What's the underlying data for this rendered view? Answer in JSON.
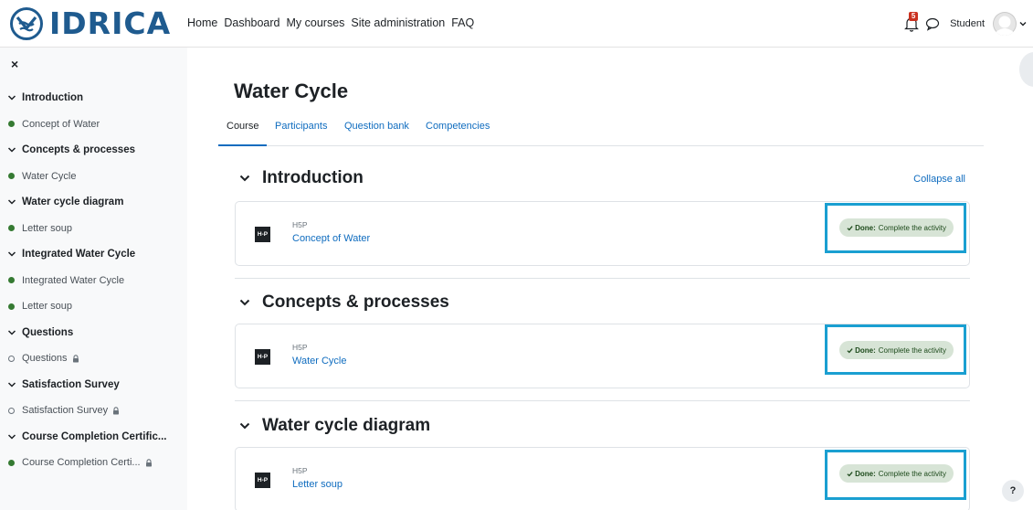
{
  "brand": {
    "name": "IDRICA"
  },
  "topnav": [
    "Home",
    "Dashboard",
    "My courses",
    "Site administration",
    "FAQ"
  ],
  "user": {
    "name": "Student",
    "notification_count": "5"
  },
  "drawer": {
    "close": "×",
    "items": [
      {
        "type": "section",
        "label": "Introduction"
      },
      {
        "type": "activity",
        "label": "Concept of Water",
        "status": "done"
      },
      {
        "type": "section",
        "label": "Concepts & processes"
      },
      {
        "type": "activity",
        "label": "Water Cycle",
        "status": "done"
      },
      {
        "type": "section",
        "label": "Water cycle diagram"
      },
      {
        "type": "activity",
        "label": "Letter soup",
        "status": "done"
      },
      {
        "type": "section",
        "label": "Integrated Water Cycle"
      },
      {
        "type": "activity",
        "label": "Integrated Water Cycle",
        "status": "done"
      },
      {
        "type": "activity",
        "label": "Letter soup",
        "status": "done"
      },
      {
        "type": "section",
        "label": "Questions"
      },
      {
        "type": "activity",
        "label": "Questions",
        "status": "open",
        "locked": true
      },
      {
        "type": "section",
        "label": "Satisfaction Survey"
      },
      {
        "type": "activity",
        "label": "Satisfaction Survey",
        "status": "open",
        "locked": true
      },
      {
        "type": "section",
        "label": "Course Completion Certific..."
      },
      {
        "type": "activity",
        "label": "Course Completion Certi...",
        "status": "done",
        "locked": true
      }
    ]
  },
  "course": {
    "title": "Water Cycle",
    "tabs": [
      "Course",
      "Participants",
      "Question bank",
      "Competencies"
    ],
    "active_tab": "Course",
    "collapse_all": "Collapse all",
    "sections": [
      {
        "title": "Introduction",
        "activity": {
          "type": "H5P",
          "name": "Concept of Water",
          "icon_text": "H-P",
          "done_label": "Done:",
          "done_text": "Complete the activity"
        }
      },
      {
        "title": "Concepts & processes",
        "activity": {
          "type": "H5P",
          "name": "Water Cycle",
          "icon_text": "H-P",
          "done_label": "Done:",
          "done_text": "Complete the activity"
        }
      },
      {
        "title": "Water cycle diagram",
        "activity": {
          "type": "H5P",
          "name": "Letter soup",
          "icon_text": "H-P",
          "done_label": "Done:",
          "done_text": "Complete the activity"
        }
      }
    ]
  },
  "help": {
    "label": "?"
  },
  "colors": {
    "brand": "#1f5b8f",
    "link": "#0f6cbf",
    "done_dot": "#357a32",
    "done_badge_bg": "#d7e4d6",
    "highlight": "#1a9fd1"
  }
}
